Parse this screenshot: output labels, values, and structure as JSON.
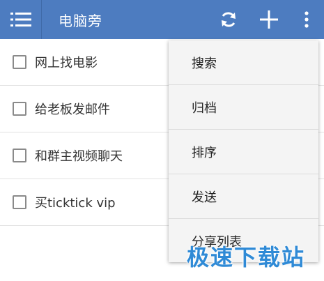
{
  "app": {
    "title": "电脑旁"
  },
  "appbar": {
    "menu_icon": "hamburger-icon",
    "actions": [
      {
        "name": "sync-icon"
      },
      {
        "name": "plus-icon"
      },
      {
        "name": "more-vertical-icon"
      }
    ],
    "color": "#4d7cc0"
  },
  "tasks": [
    {
      "label": "网上找电影",
      "checked": false
    },
    {
      "label": "给老板发邮件",
      "checked": false
    },
    {
      "label": "和群主视频聊天",
      "checked": false
    },
    {
      "label": "买ticktick vip",
      "checked": false
    }
  ],
  "overflow_menu": {
    "items": [
      {
        "label": "搜索"
      },
      {
        "label": "归档"
      },
      {
        "label": "排序"
      },
      {
        "label": "发送"
      },
      {
        "label": "分享列表"
      }
    ]
  },
  "watermark": {
    "text": "极速下载站"
  }
}
